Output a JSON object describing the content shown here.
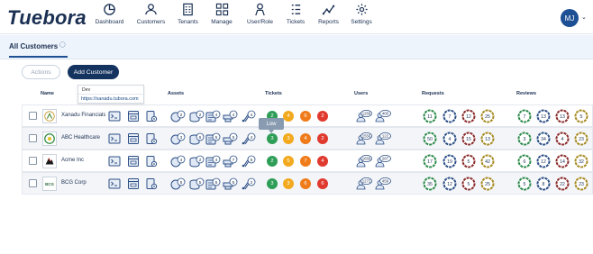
{
  "app": {
    "logo": "Tuebora"
  },
  "nav": [
    {
      "label": "Dashboard",
      "icon": "dashboard-icon"
    },
    {
      "label": "Customers",
      "icon": "customers-icon"
    },
    {
      "label": "Tenants",
      "icon": "tenants-icon"
    },
    {
      "label": "Manage",
      "icon": "manage-icon"
    },
    {
      "label": "User/Role",
      "icon": "user-role-icon"
    },
    {
      "label": "Tickets",
      "icon": "tickets-icon"
    },
    {
      "label": "Reports",
      "icon": "reports-icon"
    },
    {
      "label": "Settings",
      "icon": "settings-icon"
    }
  ],
  "user": {
    "initials": "MJ"
  },
  "page": {
    "tab_label": "All Customers"
  },
  "toolbar": {
    "actions_label": "Actions",
    "add_label": "Add Customer"
  },
  "dropdown": {
    "env": "Dev",
    "url": "https://xanadu.tubora.com"
  },
  "table": {
    "headers": {
      "name": "Name",
      "assets": "Assets",
      "tickets": "Tickets",
      "users": "Users",
      "requests": "Requests",
      "reviews": "Reviews"
    },
    "rows": [
      {
        "name": "Xanadu Financials",
        "logo": "xanadu-logo",
        "assets": [
          "2",
          "2",
          "4",
          "4",
          "4"
        ],
        "tickets": [
          "2",
          "4",
          "6",
          "2"
        ],
        "users": [
          "1256",
          "400"
        ],
        "requests": [
          "11",
          "7",
          "12",
          "25"
        ],
        "reviews": [
          "7",
          "13",
          "13",
          "5"
        ]
      },
      {
        "name": "ABC Healthcare",
        "logo": "abc-logo",
        "assets": [
          "3",
          "6",
          "5",
          "5",
          "4"
        ],
        "tickets": [
          "3",
          "3",
          "4",
          "2"
        ],
        "users": [
          "1556",
          "122"
        ],
        "requests": [
          "50",
          "4",
          "15",
          "13"
        ],
        "reviews": [
          "3",
          "34",
          "4",
          "23"
        ]
      },
      {
        "name": "Acme Inc",
        "logo": "acme-logo",
        "assets": [
          "4",
          "2",
          "4",
          "7",
          "5"
        ],
        "tickets": [
          "2",
          "5",
          "7",
          "4"
        ],
        "users": [
          "1656",
          "287"
        ],
        "requests": [
          "17",
          "19",
          "5",
          "42"
        ],
        "reviews": [
          "6",
          "12",
          "14",
          "32"
        ]
      },
      {
        "name": "BCG Corp",
        "logo": "bcg-logo",
        "assets": [
          "5",
          "5",
          "5",
          "5",
          "2"
        ],
        "tickets": [
          "3",
          "3",
          "6",
          "6"
        ],
        "users": [
          "1272",
          "459"
        ],
        "requests": [
          "35",
          "12",
          "5",
          "25"
        ],
        "reviews": [
          "5",
          "8",
          "22",
          "23"
        ]
      }
    ]
  },
  "tooltip": "Low",
  "colors": {
    "ticket": [
      "#2e9e57",
      "#f2a91e",
      "#ef7b1a",
      "#e03a2f"
    ],
    "request": [
      "#2c8a4b",
      "#2d4f86",
      "#8a2b2b",
      "#a68a22"
    ],
    "review": [
      "#2c8a4b",
      "#2d4f86",
      "#8a2b2b",
      "#a68a22"
    ],
    "primary": "#15335f"
  }
}
